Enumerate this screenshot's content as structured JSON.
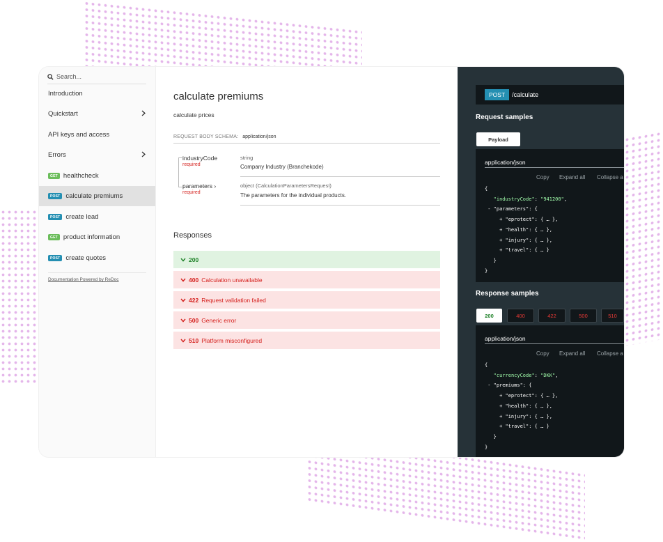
{
  "sidebar": {
    "search_placeholder": "Search...",
    "items": [
      {
        "label": "Introduction"
      },
      {
        "label": "Quickstart"
      },
      {
        "label": "API keys and access"
      },
      {
        "label": "Errors"
      },
      {
        "label": "healthcheck",
        "method": "GET"
      },
      {
        "label": "calculate premiums",
        "method": "POST"
      },
      {
        "label": "create lead",
        "method": "POST"
      },
      {
        "label": "product information",
        "method": "GET"
      },
      {
        "label": "create quotes",
        "method": "POST"
      }
    ],
    "powered_by": "Documentation Powered by ReDoc"
  },
  "main": {
    "title": "calculate premiums",
    "description": "calculate prices",
    "schema_label": "REQUEST BODY SCHEMA:",
    "schema_value": "application/json",
    "params": [
      {
        "name": "industryCode",
        "required": "required",
        "type": "string",
        "desc": "Company Industry (Branchekode)"
      },
      {
        "name": "parameters ›",
        "required": "required",
        "type": "object (CalculationParametersRequest)",
        "desc": "The parameters for the individual products."
      }
    ],
    "responses_title": "Responses",
    "responses": [
      {
        "code": "200",
        "text": ""
      },
      {
        "code": "400",
        "text": "Calculation unavailable"
      },
      {
        "code": "422",
        "text": "Request validation failed"
      },
      {
        "code": "500",
        "text": "Generic error"
      },
      {
        "code": "510",
        "text": "Platform misconfigured"
      }
    ]
  },
  "right": {
    "method": "POST",
    "path": "/calculate",
    "request_title": "Request samples",
    "request_tab": "Payload",
    "request_content_type": "application/json",
    "tools": {
      "copy": "Copy",
      "expand": "Expand all",
      "collapse": "Collapse a"
    },
    "request_code": {
      "open": "{",
      "line1_key": "\"industryCode\"",
      "line1_val": "\"941200\"",
      "line2": "- \"parameters\": {",
      "items": [
        "+ \"eprotect\": { … },",
        "+ \"health\": { … },",
        "+ \"injury\": { … },",
        "+ \"travel\": { … }"
      ],
      "inner_close": "}",
      "close": "}"
    },
    "response_title": "Response samples",
    "response_tabs": [
      "200",
      "400",
      "422",
      "500",
      "510"
    ],
    "response_content_type": "application/json",
    "response_code": {
      "open": "{",
      "line1_key": "\"currencyCode\"",
      "line1_val": "\"DKK\"",
      "line2": "- \"premiums\": {",
      "items": [
        "+ \"eprotect\": { … },",
        "+ \"health\": { … },",
        "+ \"injury\": { … },",
        "+ \"travel\": { … }"
      ],
      "inner_close": "}",
      "close": "}"
    }
  }
}
